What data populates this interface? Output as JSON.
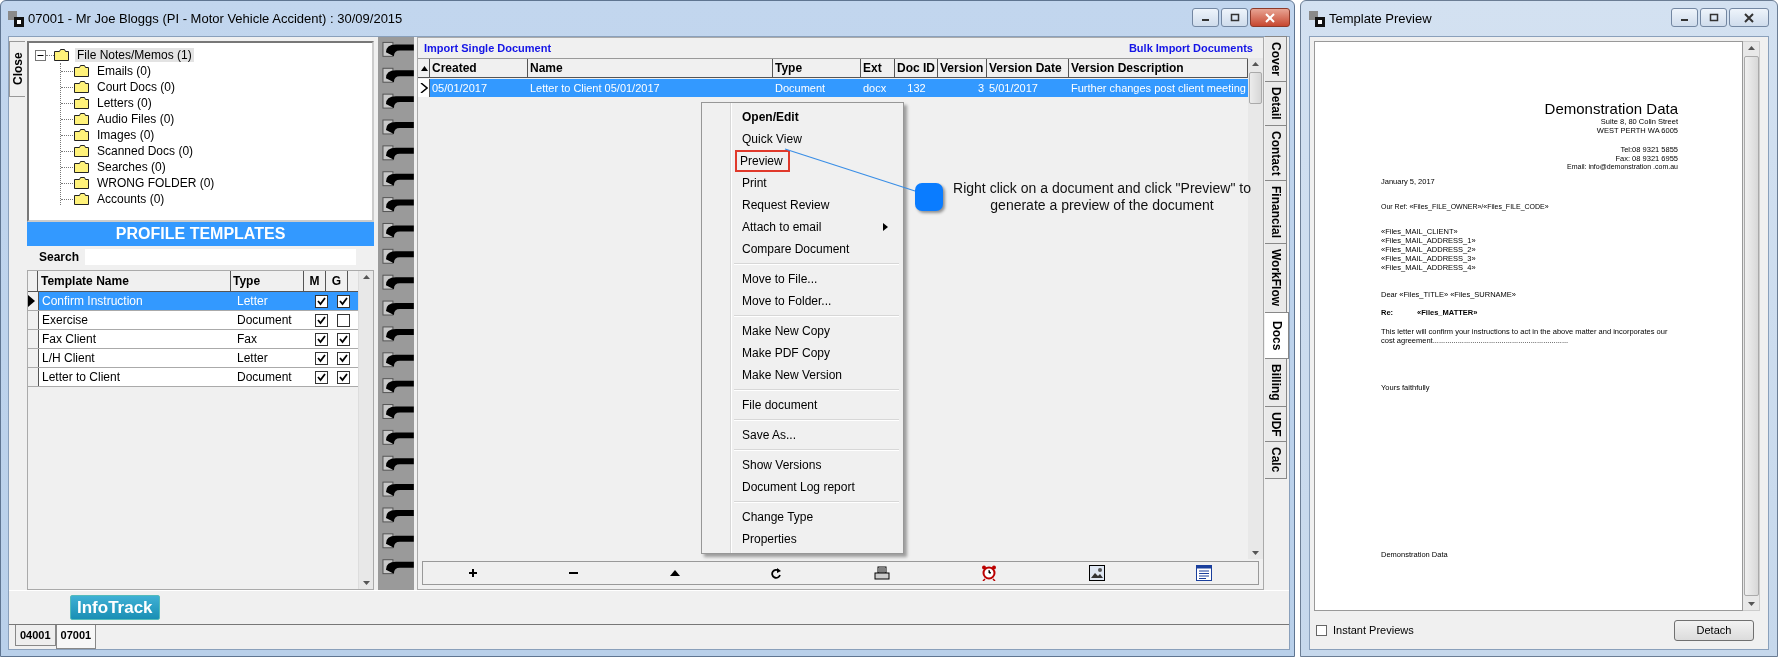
{
  "main_window": {
    "title": "07001 - Mr Joe Bloggs (PI - Motor Vehicle Accident) : 30/09/2015",
    "close_tab": "Close",
    "folder_tree": [
      {
        "label": "File Notes/Memos (1)",
        "selected": true,
        "expanded": true,
        "children": [
          {
            "label": "Emails (0)",
            "selected": false
          },
          {
            "label": "Court Docs (0)",
            "selected": false
          },
          {
            "label": "Letters (0)",
            "selected": false
          },
          {
            "label": "Audio Files (0)",
            "selected": false
          },
          {
            "label": "Images (0)",
            "selected": false
          },
          {
            "label": "Scanned Docs (0)",
            "selected": false
          },
          {
            "label": "Searches (0)",
            "selected": false
          },
          {
            "label": "WRONG FOLDER (0)",
            "selected": false
          },
          {
            "label": "Accounts (0)",
            "selected": false
          }
        ]
      }
    ],
    "profile_templates": {
      "title": "PROFILE TEMPLATES",
      "search_label": "Search",
      "columns": [
        "Template Name",
        "Type",
        "M",
        "G"
      ],
      "rows": [
        {
          "name": "Confirm Instruction",
          "type": "Letter",
          "m": true,
          "g": true,
          "selected": true
        },
        {
          "name": "Exercise",
          "type": "Document",
          "m": true,
          "g": false,
          "selected": false
        },
        {
          "name": "Fax Client",
          "type": "Fax",
          "m": true,
          "g": true,
          "selected": false
        },
        {
          "name": "L/H Client",
          "type": "Letter",
          "m": true,
          "g": true,
          "selected": false
        },
        {
          "name": "Letter to Client",
          "type": "Document",
          "m": true,
          "g": true,
          "selected": false
        }
      ]
    },
    "documents": {
      "links": [
        "Import Single Document",
        "Bulk Import Documents"
      ],
      "columns": [
        "Created",
        "Name",
        "Type",
        "Ext",
        "Doc ID",
        "Version",
        "Version Date",
        "Version Description"
      ],
      "rows": [
        {
          "cells": [
            "05/01/2017",
            "Letter to Client 05/01/2017",
            "Document",
            "docx",
            "132",
            "3",
            "5/01/2017",
            "Further changes post client meeting"
          ],
          "selected": true
        }
      ],
      "context_menu": [
        {
          "kind": "item",
          "label": "Open/Edit",
          "default": true,
          "annotated": false,
          "submenu": false
        },
        {
          "kind": "item",
          "label": "Quick View",
          "default": false,
          "annotated": false,
          "submenu": false
        },
        {
          "kind": "item",
          "label": "Preview",
          "default": false,
          "annotated": true,
          "submenu": false
        },
        {
          "kind": "item",
          "label": "Print",
          "default": false,
          "annotated": false,
          "submenu": false
        },
        {
          "kind": "item",
          "label": "Request Review",
          "default": false,
          "annotated": false,
          "submenu": false
        },
        {
          "kind": "item",
          "label": "Attach to email",
          "default": false,
          "annotated": false,
          "submenu": true
        },
        {
          "kind": "item",
          "label": "Compare Document",
          "default": false,
          "annotated": false,
          "submenu": false
        },
        {
          "kind": "separator"
        },
        {
          "kind": "item",
          "label": "Move to File...",
          "default": false,
          "annotated": false,
          "submenu": false
        },
        {
          "kind": "item",
          "label": "Move to Folder...",
          "default": false,
          "annotated": false,
          "submenu": false
        },
        {
          "kind": "separator"
        },
        {
          "kind": "item",
          "label": "Make New Copy",
          "default": false,
          "annotated": false,
          "submenu": false
        },
        {
          "kind": "item",
          "label": "Make PDF Copy",
          "default": false,
          "annotated": false,
          "submenu": false
        },
        {
          "kind": "item",
          "label": "Make New Version",
          "default": false,
          "annotated": false,
          "submenu": false
        },
        {
          "kind": "separator"
        },
        {
          "kind": "item",
          "label": "File document",
          "default": false,
          "annotated": false,
          "submenu": false
        },
        {
          "kind": "separator"
        },
        {
          "kind": "item",
          "label": "Save As...",
          "default": false,
          "annotated": false,
          "submenu": false
        },
        {
          "kind": "separator"
        },
        {
          "kind": "item",
          "label": "Show Versions",
          "default": false,
          "annotated": false,
          "submenu": false
        },
        {
          "kind": "item",
          "label": "Document Log report",
          "default": false,
          "annotated": false,
          "submenu": false
        },
        {
          "kind": "separator"
        },
        {
          "kind": "item",
          "label": "Change Type",
          "default": false,
          "annotated": false,
          "submenu": false
        },
        {
          "kind": "item",
          "label": "Properties",
          "default": false,
          "annotated": false,
          "submenu": false
        }
      ],
      "callout": "Right click on a document and click \"Preview\" to generate a preview of the document"
    },
    "side_tabs": [
      {
        "label": "Cover",
        "selected": false
      },
      {
        "label": "Detail",
        "selected": false
      },
      {
        "label": "Contact",
        "selected": false
      },
      {
        "label": "Financial",
        "selected": false
      },
      {
        "label": "WorkFlow",
        "selected": false
      },
      {
        "label": "Docs",
        "selected": true
      },
      {
        "label": "Billing",
        "selected": false
      },
      {
        "label": "UDF",
        "selected": false
      },
      {
        "label": "Calc",
        "selected": false
      }
    ],
    "infotrack_button": "InfoTrack",
    "file_tabs": [
      {
        "label": "04001",
        "selected": false
      },
      {
        "label": "07001",
        "selected": true
      }
    ]
  },
  "preview_window": {
    "title": "Template Preview",
    "document": {
      "company": "Demonstration Data",
      "address_lines": [
        "Suite 8, 80 Colin Street",
        "WEST PERTH WA 6005"
      ],
      "contact_lines": [
        "Tel:08 9321 5855",
        "Fax: 08 9321 6955"
      ],
      "email": "Email: info@demonstration .com.au",
      "date": "January 5, 2017",
      "reference": "Our Ref: «Files_FILE_OWNER»/«Files_FILE_CODE»",
      "mail_lines": [
        "«Files_MAIL_CLIENT»",
        "«Files_MAIL_ADDRESS_1»",
        "«Files_MAIL_ADDRESS_2»",
        "«Files_MAIL_ADDRESS_3»",
        "«Files_MAIL_ADDRESS_4»"
      ],
      "salutation": "Dear «Files_TITLE» «Files_SURNAME»",
      "re_label": "Re:",
      "re_value": "«Files_MATTER»",
      "body": "This letter will confirm your instructions to act in the above matter and incorporates our cost agreement.................................................................",
      "closing": "Yours faithfully",
      "signature": "Demonstration Data"
    },
    "instant_previews": {
      "label": "Instant Previews",
      "checked": false
    },
    "detach_button": "Detach"
  }
}
